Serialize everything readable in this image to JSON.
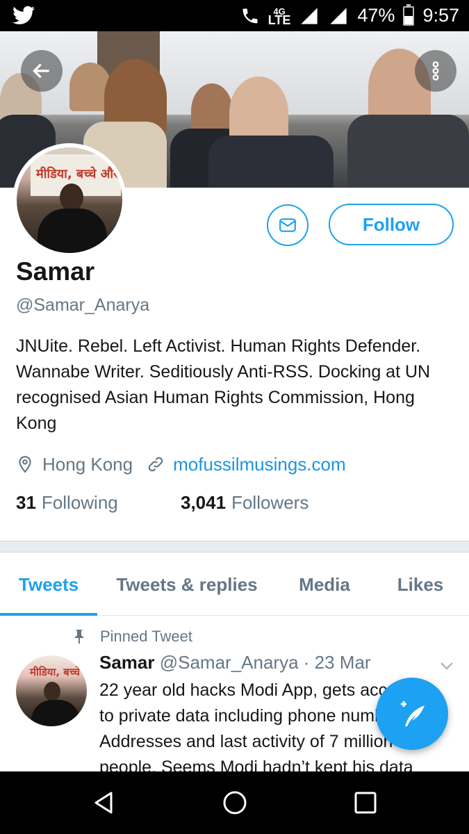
{
  "status_bar": {
    "network_top": "4G",
    "network_lte": "LTE",
    "battery": "47%",
    "time": "9:57",
    "battery_level": 0.47
  },
  "icons": {
    "status_app": "twitter-bird-icon",
    "back": "arrow-left-icon",
    "more": "more-vertical-icon",
    "message": "envelope-icon",
    "location": "location-pin-icon",
    "link": "link-icon",
    "pin": "pin-icon",
    "caret": "chevron-down-icon",
    "compose": "compose-tweet-icon"
  },
  "profile": {
    "name": "Samar",
    "handle": "@Samar_Anarya",
    "bio": "JNUite. Rebel. Left Activist. Human Rights Defender. Wannabe Writer. Seditiously Anti-RSS. Docking at UN recognised Asian Human Rights Commission, Hong Kong",
    "location": "Hong Kong",
    "website": "mofussilmusings.com",
    "following_count": "31",
    "following_label": "Following",
    "followers_count": "3,041",
    "followers_label": "Followers",
    "follow_label": "Follow",
    "avatar_banner_text": "मीडिया, बच्चे और"
  },
  "tabs": [
    {
      "label": "Tweets",
      "active": true
    },
    {
      "label": "Tweets & replies",
      "active": false
    },
    {
      "label": "Media",
      "active": false
    },
    {
      "label": "Likes",
      "active": false
    }
  ],
  "tweet": {
    "pinned_label": "Pinned Tweet",
    "author_name": "Samar",
    "author_meta": "@Samar_Anarya · 23 Mar",
    "lines": [
      "22 year old hacks Modi App, gets access",
      "to private data including phone numbers,",
      "Addresses and last activity of 7 million",
      "people. Seems Modi hadn’t kept his data"
    ]
  },
  "colors": {
    "accent": "#1da1f2",
    "link": "#1b95e0",
    "secondary_text": "#657786"
  }
}
